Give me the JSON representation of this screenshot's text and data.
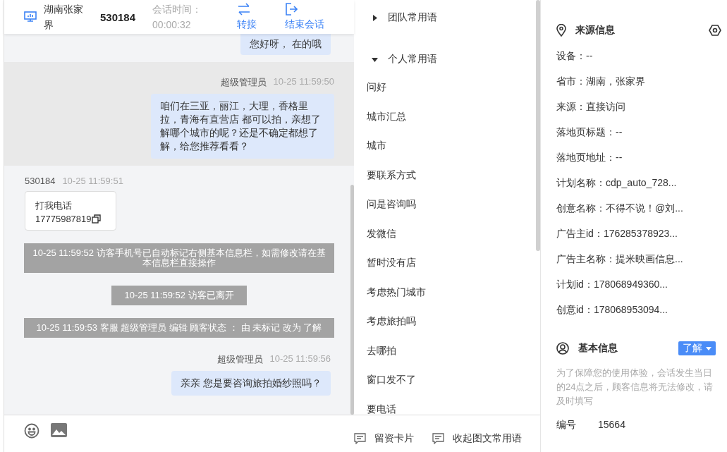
{
  "header": {
    "location": "湖南张家界",
    "visitor_id": "530184",
    "session_label": "会话时间：",
    "session_time": "00:00:32",
    "actions": [
      "转接",
      "结束会话"
    ]
  },
  "messages": [
    {
      "kind": "agent",
      "text": "您好呀， 在的哦",
      "highlighted": false
    },
    {
      "kind": "agent",
      "sender": "超级管理员",
      "time": "10-25 11:59:50",
      "text": "咱们在三亚，丽江，大理，香格里拉，青海有直营店 都可以拍，亲想了解哪个城市的呢？还是不确定都想了解，给您推荐看看？",
      "highlighted": true
    },
    {
      "kind": "visitor",
      "sender": "530184",
      "time": "10-25 11:59:51",
      "text": "打我电话",
      "phone": "17775987819"
    },
    {
      "kind": "system",
      "text": "10-25 11:59:52 访客手机号已自动标记右侧基本信息栏，如需修改请在基本信息栏直接操作"
    },
    {
      "kind": "system",
      "text": "10-25 11:59:52 访客已离开"
    },
    {
      "kind": "system",
      "text": "10-25 11:59:53 客服 超级管理员 编辑 顾客状态 ： 由 未标记 改为 了解"
    },
    {
      "kind": "agent",
      "sender": "超级管理员",
      "time": "10-25 11:59:56",
      "text": "亲亲 您是要咨询旅拍婚纱照吗？",
      "highlighted": false
    }
  ],
  "phrase_groups": [
    {
      "label": "团队常用语",
      "expanded": false
    },
    {
      "label": "个人常用语",
      "expanded": true,
      "items": [
        "问好",
        "城市汇总",
        "城市",
        "要联系方式",
        "问是咨询吗",
        "发微信",
        "暂时没有店",
        "考虑热门城市",
        "考虑旅拍吗",
        "去哪拍",
        "窗口发不了",
        "要电话"
      ]
    }
  ],
  "phrase_footer": [
    "留资卡片",
    "收起图文常用语"
  ],
  "source_info": {
    "title": "来源信息",
    "fields": [
      "设备：--",
      "省市：湖南，张家界",
      "来源：直接访问",
      "落地页标题：--",
      "落地页地址：--",
      "计划名称：cdp_auto_728...",
      "创意名称：不得不说！@刘...",
      "广告主id：176285378923...",
      "广告主名称：提米映画信息...",
      "计划id：178068949360...",
      "创意id：178068953094..."
    ]
  },
  "basic_info": {
    "title": "基本信息",
    "status": "了解",
    "note": "为了保障您的使用体验，会话发生当日的24点之后，顾客信息将无法修改，请及时填写",
    "fields": [
      {
        "label": "编号",
        "value": "15664"
      }
    ]
  }
}
